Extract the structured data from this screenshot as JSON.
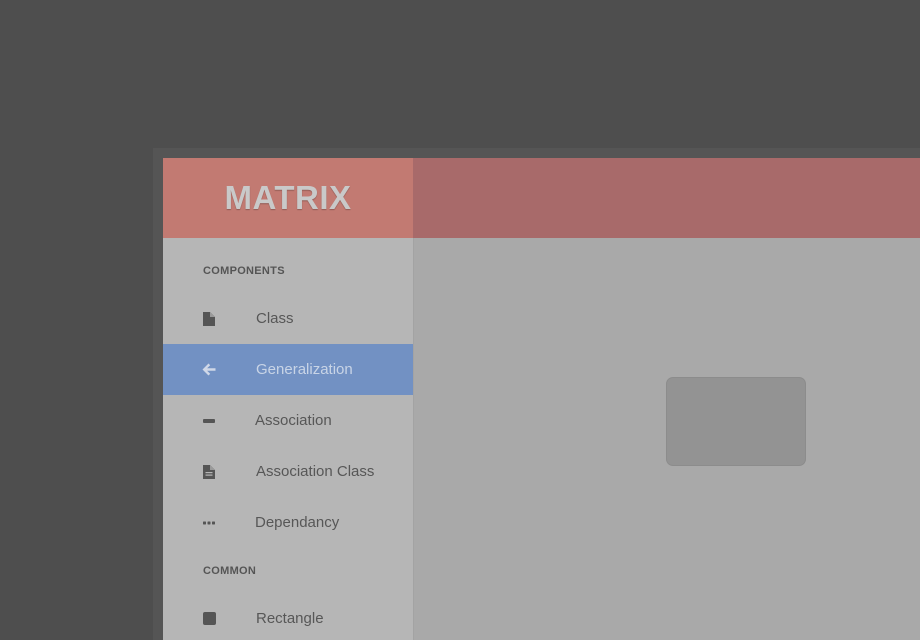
{
  "app": {
    "title": "MATRIX"
  },
  "sidebar": {
    "sections": [
      {
        "title": "COMPONENTS",
        "items": [
          {
            "label": "Class",
            "icon": "document-icon"
          },
          {
            "label": "Generalization",
            "icon": "arrow-left-icon",
            "active": true
          },
          {
            "label": "Association",
            "icon": "line-icon"
          },
          {
            "label": "Association Class",
            "icon": "document-lines-icon"
          },
          {
            "label": "Dependancy",
            "icon": "dotted-line-icon"
          }
        ]
      },
      {
        "title": "COMMON",
        "items": [
          {
            "label": "Rectangle",
            "icon": "square-icon"
          }
        ]
      }
    ]
  },
  "colors": {
    "header": "#a86a6a",
    "brand": "#c27a72",
    "active_item": "#7291c3",
    "sidebar": "#b6b6b6",
    "canvas": "#a9a9a9"
  }
}
